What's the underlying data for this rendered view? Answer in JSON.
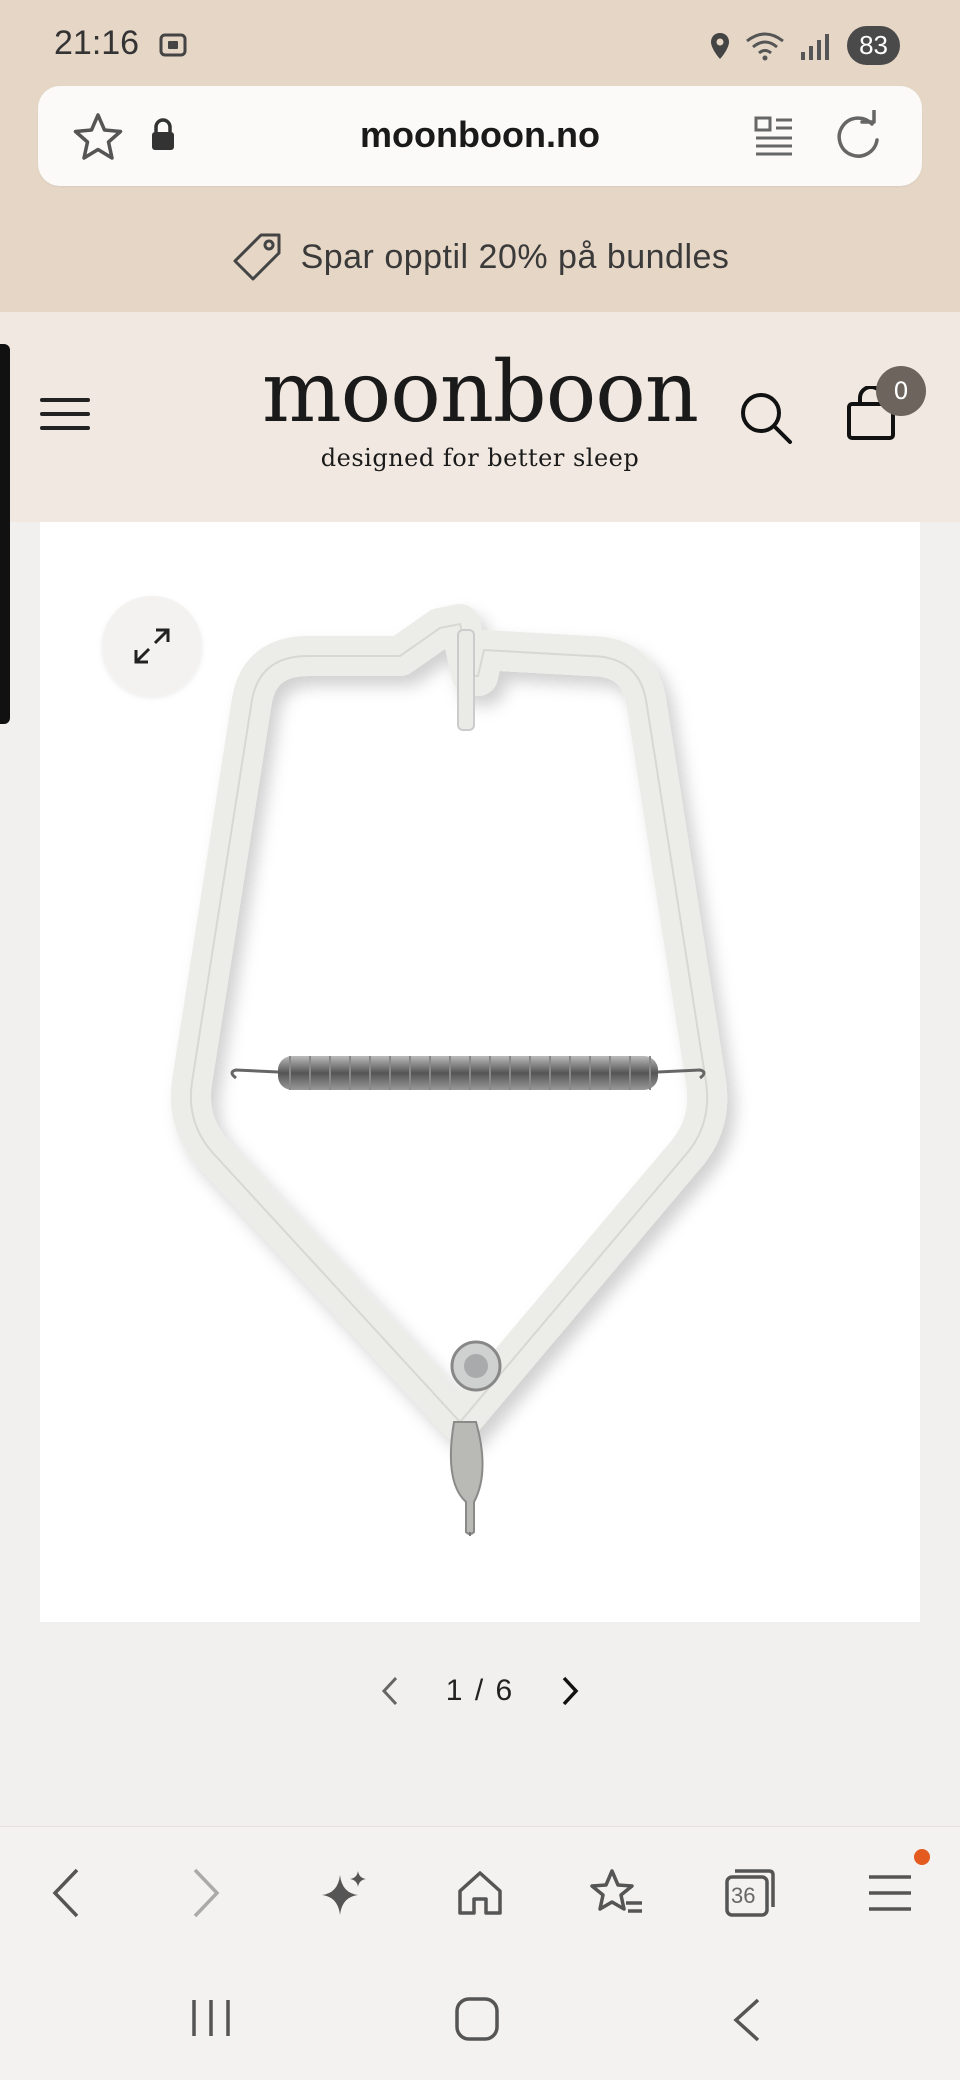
{
  "status_bar": {
    "time": "21:16",
    "battery": "83"
  },
  "browser": {
    "url": "moonboon.no"
  },
  "promo": {
    "text": "Spar opptil 20% på bundles"
  },
  "site": {
    "logo": "moonboon",
    "tagline": "designed for better sleep",
    "cart_count": "0"
  },
  "gallery": {
    "current": "1",
    "separator": "/",
    "total": "6"
  },
  "toolbar": {
    "tab_count": "36"
  },
  "colors": {
    "chrome_bg": "#e6d6c6",
    "header_bg": "#f1e9e1",
    "badge": "#6d655d",
    "notify_dot": "#e35b1e"
  }
}
